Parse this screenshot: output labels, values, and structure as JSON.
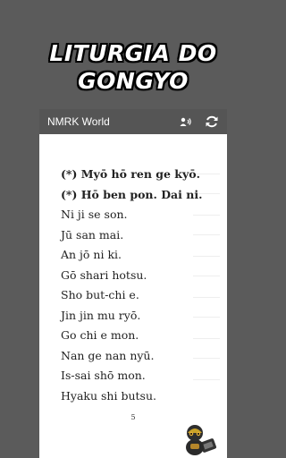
{
  "banner": {
    "line1": "LITURGIA DO",
    "line2": "GONGYO"
  },
  "appbar": {
    "title": "NMRK World",
    "icons": [
      "audio-person-icon",
      "refresh-icon"
    ]
  },
  "page": {
    "lines": [
      {
        "text": "(*) Myō hō ren ge kyō.",
        "bold": true
      },
      {
        "text": "(*) Hō ben pon. Dai ni.",
        "bold": true
      },
      {
        "text": "Ni ji se son.",
        "bold": false
      },
      {
        "text": "Jū san mai.",
        "bold": false
      },
      {
        "text": "An jō ni ki.",
        "bold": false
      },
      {
        "text": "Gō shari hotsu.",
        "bold": false
      },
      {
        "text": "Sho but-chi e.",
        "bold": false
      },
      {
        "text": "Jin jin mu ryō.",
        "bold": false
      },
      {
        "text": "Go chi e mon.",
        "bold": false
      },
      {
        "text": "Nan ge nan nyū.",
        "bold": false
      },
      {
        "text": "Is-sai shō mon.",
        "bold": false
      },
      {
        "text": "Hyaku shi butsu.",
        "bold": false
      }
    ],
    "page_number": "5"
  },
  "colors": {
    "background": "#5b5b5b",
    "appbar": "#555555",
    "page": "#ffffff"
  }
}
